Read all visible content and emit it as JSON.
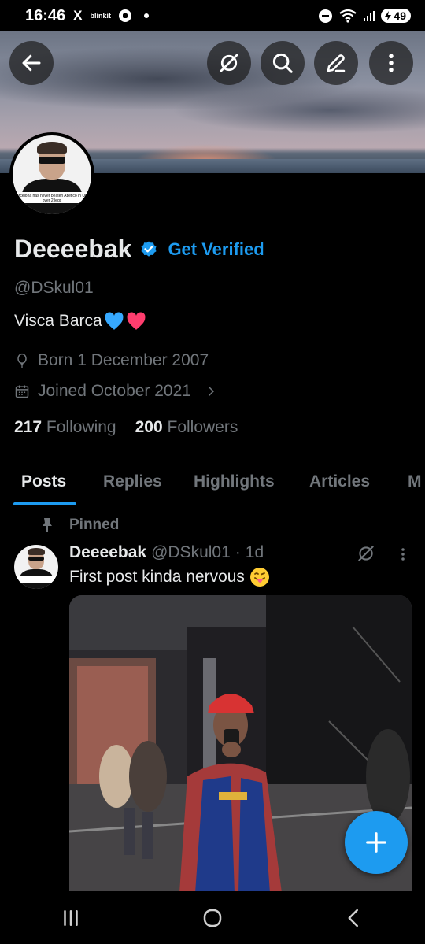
{
  "status_bar": {
    "time": "16:46",
    "x_icon": "X",
    "app_label": "blinkit",
    "battery": "49"
  },
  "header_actions": {
    "back": "back-arrow-icon",
    "grok": "grok-icon",
    "search": "search-icon",
    "edit": "edit-pencil-icon",
    "more": "more-vertical-icon"
  },
  "profile": {
    "display_name": "Deeeebak",
    "get_verified": "Get Verified",
    "handle": "@DSkul01",
    "bio": "Visca Barca",
    "birth": "Born 1 December 2007",
    "joined": "Joined October 2021",
    "following_count": "217",
    "following_label": "Following",
    "followers_count": "200",
    "followers_label": "Followers",
    "avatar_caption": "Barcelona has never beaten Atletico in UCL over 2 legs"
  },
  "tabs": [
    {
      "label": "Posts",
      "active": true
    },
    {
      "label": "Replies",
      "active": false
    },
    {
      "label": "Highlights",
      "active": false
    },
    {
      "label": "Articles",
      "active": false
    },
    {
      "label": "M",
      "active": false
    }
  ],
  "post": {
    "pinned_label": "Pinned",
    "author_name": "Deeeebak",
    "author_handle": "@DSkul01",
    "separator": "·",
    "age": "1d",
    "text": "First post kinda nervous",
    "image_alt": "Mirror selfie in red cap and Barcelona jersey"
  },
  "colors": {
    "accent": "#1d9bf0",
    "background": "#000000",
    "text_primary": "#e7e9ea",
    "text_secondary": "#71767b",
    "heart_blue": "#36a9ff",
    "heart_pink": "#ff3d6e"
  }
}
